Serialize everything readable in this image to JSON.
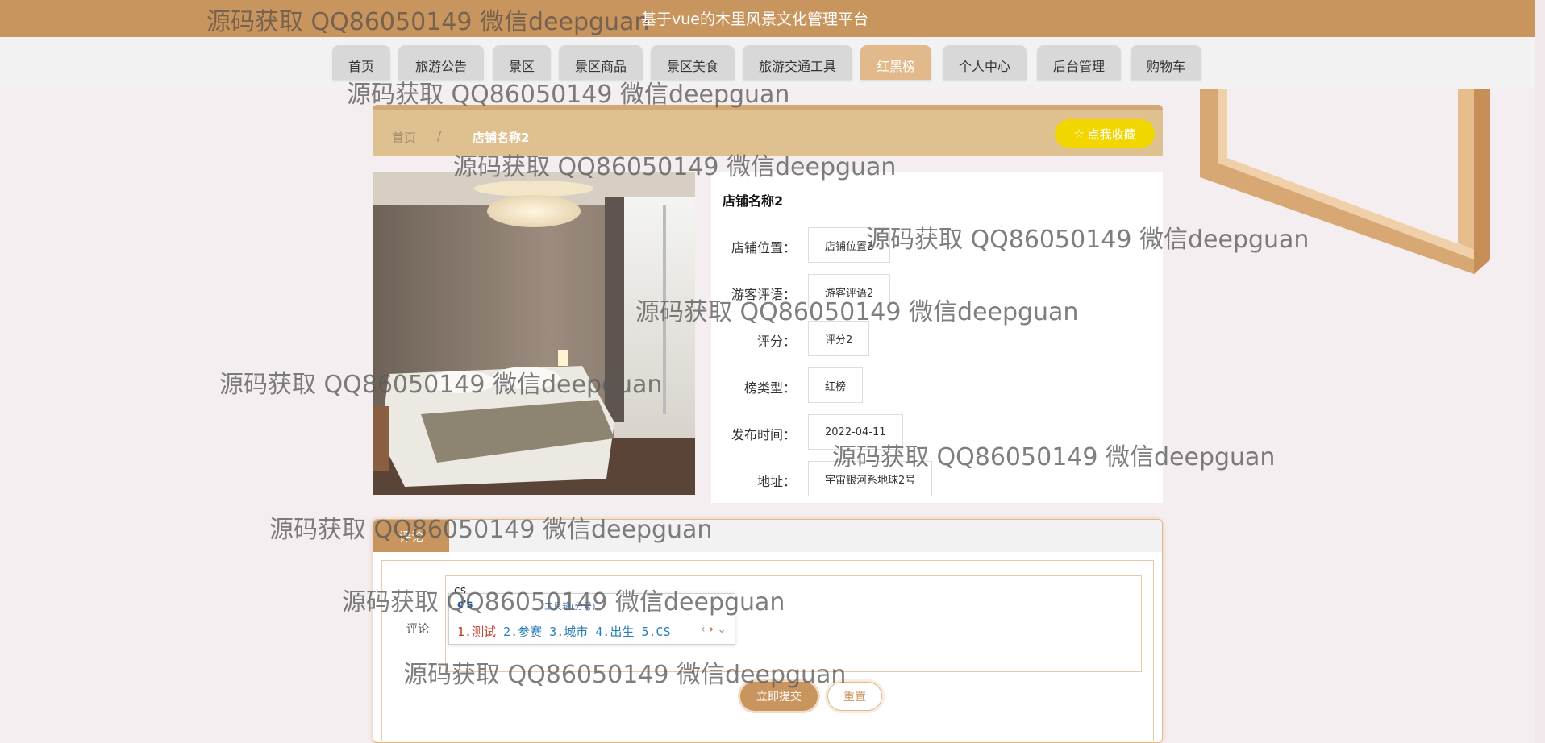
{
  "header": {
    "watermark": "源码获取 QQ86050149 微信deepguan",
    "site_title": "基于vue的木里风景文化管理平台"
  },
  "nav": {
    "items": [
      {
        "label": "首页"
      },
      {
        "label": "旅游公告"
      },
      {
        "label": "景区"
      },
      {
        "label": "景区商品"
      },
      {
        "label": "景区美食"
      },
      {
        "label": "旅游交通工具"
      },
      {
        "label": "红黑榜"
      },
      {
        "label": "个人中心"
      },
      {
        "label": "后台管理"
      },
      {
        "label": "购物车"
      }
    ],
    "active": "红黑榜"
  },
  "breadcrumb": {
    "home": "首页",
    "separator": "/",
    "current": "店铺名称2"
  },
  "favorite_button": {
    "icon": "star-icon",
    "label": "点我收藏"
  },
  "detail": {
    "name": "店铺名称2",
    "fields": [
      {
        "label": "店铺位置：",
        "value": "店铺位置2"
      },
      {
        "label": "游客评语：",
        "value": "游客评语2"
      },
      {
        "label": "评分：",
        "value": "评分2"
      },
      {
        "label": "榜类型：",
        "value": "红榜"
      },
      {
        "label": "发布时间：",
        "value": "2022-04-11"
      },
      {
        "label": "地址：",
        "value": "宇宙银河系地球2号"
      }
    ]
  },
  "comment": {
    "tab": "评论",
    "label": "评论",
    "input_value": "cs",
    "submit_label": "立即提交",
    "reset_label": "重置"
  },
  "ime": {
    "pinyin": "c's",
    "toolbox": "工具箱(分号)",
    "candidates": [
      "1.测试",
      "2.参赛",
      "3.城市",
      "4.出生",
      "5.CS"
    ]
  },
  "watermark_text": "源码获取 QQ86050149 微信deepguan",
  "colors": {
    "accent": "#c9955f",
    "crumb_bar": "#dfc08f",
    "favorite": "#f2d600",
    "active_tab": "#e2b98a"
  }
}
